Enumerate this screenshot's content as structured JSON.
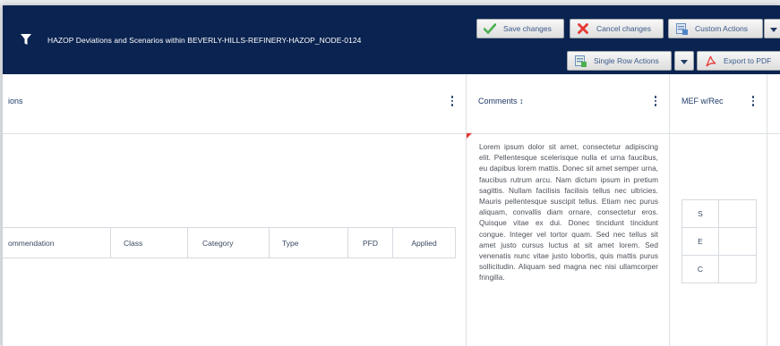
{
  "header": {
    "title": "HAZOP Deviations and Scenarios within BEVERLY-HILLS-REFINERY-HAZOP_NODE-0124",
    "buttons": {
      "save": "Save changes",
      "cancel": "Cancel changes",
      "custom": "Custom Actions",
      "single_row": "Single Row Actions",
      "export": "Export to PDF"
    }
  },
  "columns": {
    "left_partial": "ions",
    "comments": "Comments ↕",
    "mef": "MEF w/Rec"
  },
  "recommendation_table": {
    "headers": [
      "ommendation",
      "Class",
      "Category",
      "Type",
      "PFD",
      "Applied"
    ]
  },
  "comments_text": "Lorem ipsum dolor sit amet, consectetur adipiscing elit. Pellentesque scelerisque nulla et urna faucibus, eu dapibus lorem mattis. Donec sit amet semper urna, faucibus rutrum arcu. Nam dictum ipsum in pretium sagittis. Nullam facilisis facilisis tellus nec ultricies. Mauris pellentesque suscipit tellus. Etiam nec purus aliquam, convallis diam ornare, consectetur eros. Quisque vitae ex dui. Donec tincidunt tincidunt congue. Integer vel tortor quam. Sed nec tellus sit amet justo cursus luctus at sit amet lorem. Sed venenatis nunc vitae justo lobortis, quis mattis purus sollicitudin. Aliquam sed magna nec nisi ullamcorper fringilla.",
  "mef_grid": {
    "rows": [
      "S",
      "E",
      "C"
    ]
  },
  "colors": {
    "header_bg": "#0a2350",
    "accent_red": "#e53935",
    "save_green": "#4caf50"
  }
}
